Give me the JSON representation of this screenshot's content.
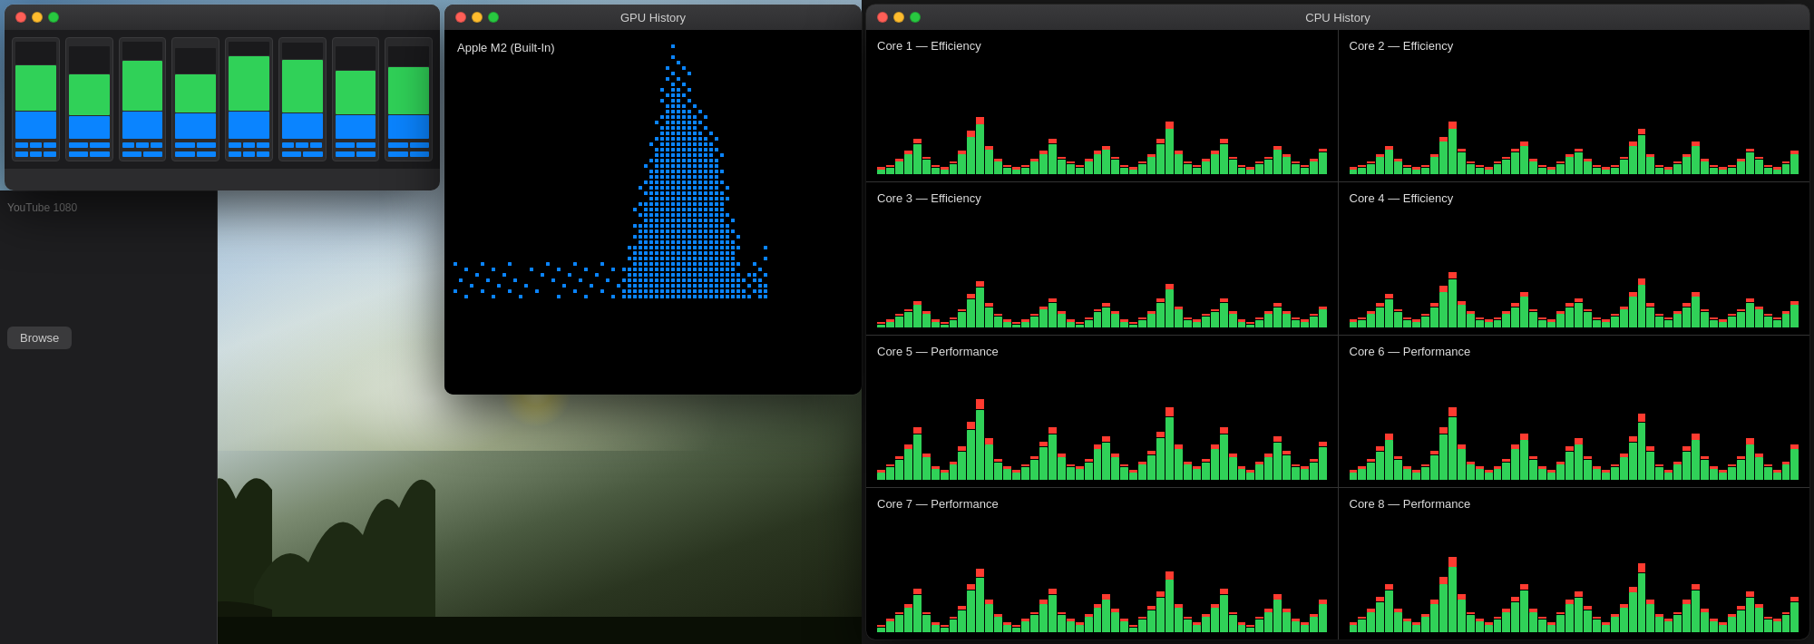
{
  "windows": {
    "activity": {
      "title": "",
      "traffic_lights": [
        "close",
        "minimize",
        "maximize"
      ],
      "cpu_bars": [
        {
          "green_pct": 45,
          "blue_pct": 30
        },
        {
          "green_pct": 40,
          "blue_pct": 25
        },
        {
          "green_pct": 50,
          "blue_pct": 35
        },
        {
          "green_pct": 38,
          "blue_pct": 28
        },
        {
          "green_pct": 60,
          "blue_pct": 40
        },
        {
          "green_pct": 55,
          "blue_pct": 38
        },
        {
          "green_pct": 42,
          "blue_pct": 32
        },
        {
          "green_pct": 48,
          "blue_pct": 33
        }
      ]
    },
    "gpu": {
      "title": "GPU History",
      "label": "Apple M2 (Built-In)"
    },
    "cpu_history": {
      "title": "CPU History",
      "cores": [
        {
          "name": "Core 1 — Efficiency",
          "bars": [
            2,
            3,
            5,
            8,
            12,
            6,
            3,
            2,
            4,
            8,
            15,
            20,
            10,
            5,
            3,
            2,
            3,
            5,
            8,
            12,
            6,
            4,
            3,
            5,
            8,
            10,
            6,
            3,
            2,
            4,
            7,
            12,
            18,
            8,
            4,
            3,
            5,
            8,
            12,
            6,
            3,
            2,
            4,
            6,
            10,
            7,
            4,
            3,
            5,
            9
          ]
        },
        {
          "name": "Core 2 — Efficiency",
          "bars": [
            2,
            3,
            4,
            7,
            10,
            5,
            3,
            2,
            3,
            7,
            13,
            18,
            9,
            4,
            3,
            2,
            4,
            6,
            9,
            11,
            5,
            3,
            2,
            4,
            7,
            9,
            5,
            3,
            2,
            3,
            6,
            11,
            16,
            7,
            3,
            2,
            4,
            7,
            11,
            5,
            3,
            2,
            3,
            5,
            9,
            6,
            3,
            2,
            4,
            8
          ]
        },
        {
          "name": "Core 3 — Efficiency",
          "bars": [
            1,
            2,
            4,
            6,
            9,
            5,
            2,
            1,
            3,
            6,
            11,
            16,
            8,
            4,
            2,
            1,
            2,
            4,
            7,
            10,
            5,
            2,
            1,
            3,
            6,
            8,
            5,
            2,
            1,
            3,
            5,
            10,
            15,
            7,
            3,
            2,
            4,
            6,
            10,
            5,
            2,
            1,
            3,
            5,
            8,
            5,
            3,
            2,
            4,
            7
          ]
        },
        {
          "name": "Core 4 — Efficiency",
          "bars": [
            2,
            3,
            5,
            8,
            11,
            6,
            3,
            2,
            4,
            8,
            14,
            19,
            9,
            5,
            3,
            2,
            3,
            5,
            8,
            12,
            6,
            3,
            2,
            5,
            8,
            10,
            6,
            3,
            2,
            4,
            7,
            12,
            17,
            8,
            4,
            3,
            5,
            8,
            12,
            6,
            3,
            2,
            4,
            6,
            10,
            7,
            4,
            3,
            5,
            9
          ]
        },
        {
          "name": "Core 5 — Performance",
          "bars": [
            3,
            5,
            8,
            12,
            18,
            9,
            4,
            3,
            6,
            11,
            20,
            28,
            14,
            7,
            4,
            3,
            5,
            8,
            13,
            18,
            9,
            5,
            4,
            7,
            12,
            15,
            9,
            5,
            3,
            6,
            10,
            17,
            25,
            12,
            6,
            4,
            7,
            12,
            18,
            9,
            4,
            3,
            6,
            9,
            15,
            10,
            5,
            4,
            7,
            13
          ]
        },
        {
          "name": "Core 6 — Performance",
          "bars": [
            3,
            4,
            7,
            11,
            16,
            8,
            4,
            3,
            5,
            10,
            18,
            25,
            12,
            6,
            4,
            3,
            4,
            7,
            12,
            16,
            8,
            4,
            3,
            6,
            11,
            14,
            8,
            4,
            3,
            5,
            9,
            15,
            23,
            11,
            5,
            3,
            6,
            11,
            16,
            8,
            4,
            3,
            5,
            8,
            14,
            9,
            5,
            3,
            6,
            12
          ]
        },
        {
          "name": "Core 7 — Performance",
          "bars": [
            2,
            4,
            7,
            10,
            15,
            7,
            3,
            2,
            5,
            9,
            17,
            22,
            11,
            6,
            3,
            2,
            4,
            7,
            11,
            15,
            7,
            4,
            3,
            6,
            10,
            13,
            8,
            4,
            2,
            5,
            9,
            14,
            21,
            10,
            5,
            3,
            6,
            10,
            15,
            7,
            3,
            2,
            5,
            8,
            13,
            8,
            4,
            3,
            6,
            11
          ]
        },
        {
          "name": "Core 8 — Performance",
          "bars": [
            3,
            5,
            8,
            12,
            17,
            8,
            4,
            3,
            6,
            11,
            19,
            26,
            13,
            7,
            4,
            3,
            5,
            8,
            12,
            17,
            8,
            5,
            3,
            7,
            11,
            14,
            9,
            5,
            3,
            6,
            10,
            16,
            24,
            11,
            6,
            4,
            7,
            11,
            17,
            8,
            4,
            3,
            6,
            9,
            14,
            10,
            5,
            4,
            7,
            12
          ]
        }
      ]
    }
  },
  "app_panel": {
    "text": "YouTube 1080",
    "browse_label": "Browse"
  }
}
